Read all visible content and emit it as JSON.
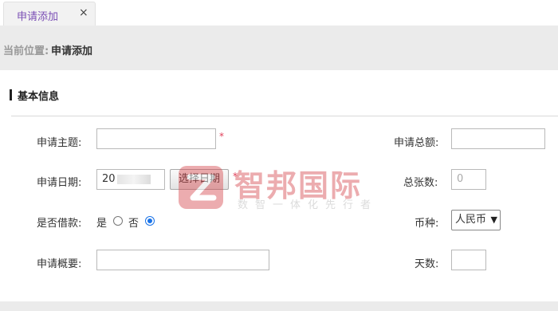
{
  "tab": {
    "label": "申请添加",
    "close": "×"
  },
  "breadcrumb": {
    "prefix": "当前位置:",
    "current": "申请添加"
  },
  "section": {
    "title": "基本信息"
  },
  "form": {
    "subject_label": "申请主题:",
    "subject_value": "",
    "required_mark": "*",
    "total_amount_label": "申请总额:",
    "total_amount_value": "",
    "date_label": "申请日期:",
    "date_value": "20",
    "choose_date_button": "选择日期",
    "sheets_label": "总张数:",
    "sheets_placeholder": "0",
    "loan_label": "是否借款:",
    "loan_options": [
      {
        "label": "是",
        "checked": false
      },
      {
        "label": "否",
        "checked": true
      }
    ],
    "currency_label": "币种:",
    "currency_selected": "人民币",
    "summary_label": "申请概要:",
    "summary_value": "",
    "days_label": "天数:",
    "days_value": ""
  },
  "watermark": {
    "name": "智邦国际",
    "slogan": "数智一体化先行者",
    "color": "#d64a4f"
  },
  "icons": {
    "tab_close": "close-icon",
    "select_caret": "chevron-down-icon"
  }
}
